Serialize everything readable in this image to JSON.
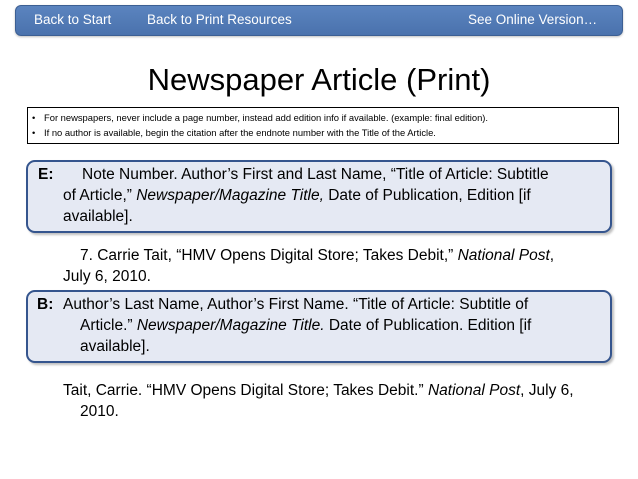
{
  "nav": {
    "back_to_start": "Back to Start",
    "back_to_print": "Back to Print Resources",
    "see_online": "See Online Version…"
  },
  "title": "Newspaper Article (Print)",
  "notes": [
    "For newspapers, never include a page number, instead add edition info if available. (example: final edition).",
    "If no author is available, begin the citation after the endnote number with the Title of the Article."
  ],
  "endnote": {
    "label": "E:",
    "format": {
      "l1": "Note Number. Author’s First and Last Name, “Title of Article: Subtitle",
      "l2_a": "of Article,” ",
      "l2_i": "Newspaper/Magazine Title,",
      "l2_b": " Date of Publication, Edition [if",
      "l3": "available]."
    },
    "example": {
      "l1_a": "7. Carrie Tait, “HMV Opens Digital Store; Takes Debit,” ",
      "l1_i": "National Post",
      "l1_b": ",",
      "l2": "July 6, 2010."
    }
  },
  "bibliography": {
    "label": "B:",
    "format": {
      "l1": "Author’s Last Name, Author’s First Name. “Title of Article: Subtitle of",
      "l2_a": "Article.” ",
      "l2_i": "Newspaper/Magazine Title.",
      "l2_b": " Date of Publication. Edition [if",
      "l3": "available]."
    },
    "example": {
      "l1_a": "Tait, Carrie. “HMV Opens Digital Store; Takes Debit.” ",
      "l1_i": "National Post",
      "l1_b": ", July 6,",
      "l2": "2010."
    }
  }
}
